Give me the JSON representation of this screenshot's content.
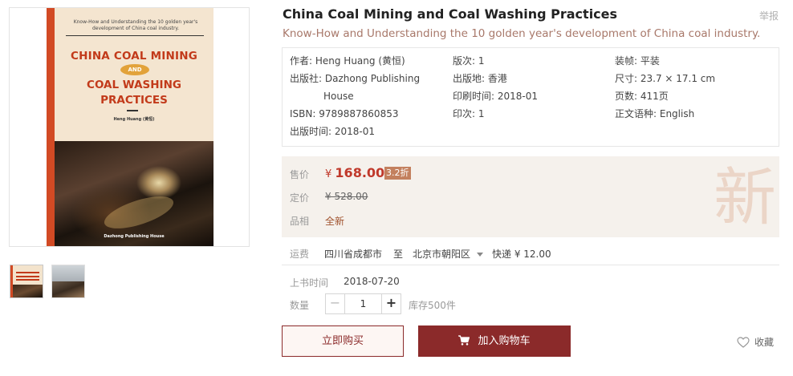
{
  "gallery": {
    "cover": {
      "subtitle": "Know-How and Understanding the 10 golden year's development of China coal industry.",
      "title_line1": "CHINA COAL MINING",
      "title_and": "AND",
      "title_line2": "COAL WASHING",
      "title_line3": "PRACTICES",
      "author": "Heng Huang (黄恒)",
      "publisher": "Dazhong Publishing House"
    },
    "thumbnails": [
      "cover-thumbnail",
      "mining-photo-thumbnail"
    ]
  },
  "product": {
    "title": "China Coal Mining and Coal Washing Practices",
    "subtitle": "Know-How and Understanding the 10 golden year's development of China coal industry.",
    "report_label": "举报"
  },
  "attributes": {
    "author": "作者: Heng Huang (黄恒)",
    "edition": "版次: 1",
    "binding": "装帧: 平装",
    "publisher_line1": "出版社: Dazhong Publishing",
    "publisher_line2": "House",
    "place": "出版地: 香港",
    "size": "尺寸: 23.7 × 17.1 cm",
    "print_time": "印刷时间: 2018-01",
    "pages": "页数: 411页",
    "isbn": "ISBN: 9789887860853",
    "impression": "印次: 1",
    "language": "正文语种: English",
    "publish_time": "出版时间: 2018-01"
  },
  "price": {
    "sale_label": "售价",
    "currency": "¥",
    "sale_value": "168.00",
    "discount": "3.2折",
    "orig_label": "定价",
    "orig_value": "¥ 528.00",
    "condition_label": "品相",
    "condition_value": "全新",
    "stamp": "新"
  },
  "shipping": {
    "label": "运费",
    "from": "四川省成都市",
    "to_word": "至",
    "destination": "北京市朝阳区",
    "method": "快递 ¥ 12.00"
  },
  "listing": {
    "date_label": "上书时间",
    "date_value": "2018-07-20"
  },
  "quantity": {
    "label": "数量",
    "value": "1",
    "minus": "−",
    "plus": "+",
    "stock": "库存500件"
  },
  "actions": {
    "buy_now": "立即购买",
    "add_to_cart": "加入购物车",
    "favorite": "收藏"
  },
  "colors": {
    "accent": "#8b2a2a",
    "price": "#c0392b",
    "discount_bg": "#c3805e",
    "subtitle": "#a8786a"
  }
}
